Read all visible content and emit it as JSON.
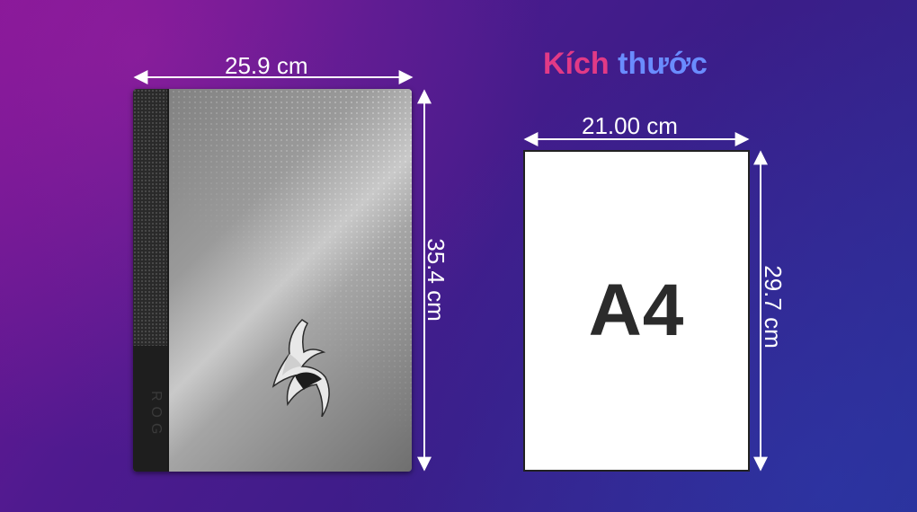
{
  "title": {
    "word1": "Kích",
    "word2": "thước",
    "colors": {
      "word1": "#e23a86",
      "word2": "#6a8cff"
    }
  },
  "laptop": {
    "width_label": "25.9 cm",
    "height_label": "35.4 cm",
    "logo_icon": "rog-eye-icon"
  },
  "paper": {
    "label": "A4",
    "width_label": "21.00 cm",
    "height_label": "29.7 cm"
  }
}
